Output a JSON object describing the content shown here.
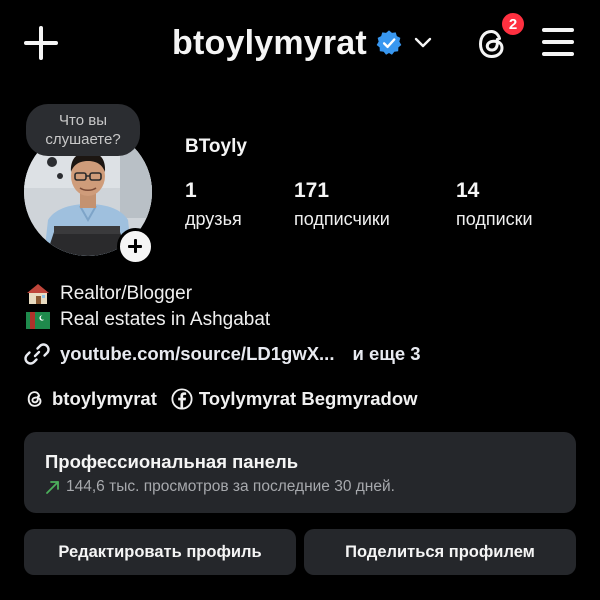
{
  "header": {
    "username": "btoylymyrat",
    "notification_count": "2",
    "verified_color": "#3897f0",
    "badge_color": "#ff3040"
  },
  "profile": {
    "note_text": "Что вы слушаете?",
    "display_name": "BToyly",
    "stats": [
      {
        "value": "1",
        "label": "друзья"
      },
      {
        "value": "171",
        "label": "подписчики"
      },
      {
        "value": "14",
        "label": "подписки"
      }
    ]
  },
  "bio": {
    "line1": "Realtor/Blogger",
    "line2": "Real estates in Ashgabat",
    "link": "youtube.com/source/LD1gwX...",
    "link_more": "и еще 3",
    "threads_handle": "btoylymyrat",
    "facebook_name": "Toylymyrat Begmyradow"
  },
  "dashboard": {
    "title": "Профессиональная панель",
    "subtitle": "144,6 тыс. просмотров за последние 30 дней.",
    "trend_color": "#4cb05c"
  },
  "actions": {
    "edit_label": "Редактировать профиль",
    "share_label": "Поделиться профилем"
  }
}
